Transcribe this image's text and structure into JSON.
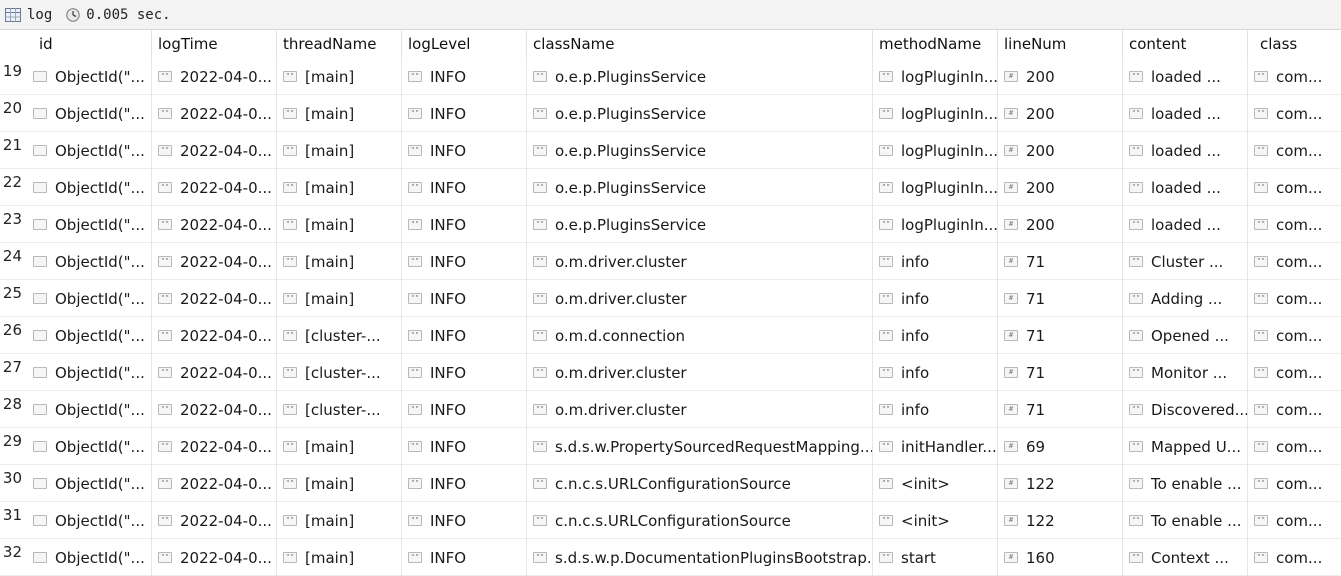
{
  "toolbar": {
    "collection": "log",
    "elapsed": "0.005 sec."
  },
  "columns": [
    "id",
    "logTime",
    "threadName",
    "logLevel",
    "className",
    "methodName",
    "lineNum",
    "content",
    "class"
  ],
  "rows": [
    {
      "n": "19",
      "id": "ObjectId(\"...",
      "logTime": "2022-04-0...",
      "threadName": "[main]",
      "logLevel": "INFO",
      "className": "o.e.p.PluginsService",
      "methodName": "logPluginIn...",
      "lineNum": "200",
      "content": "loaded ...",
      "class": "com..."
    },
    {
      "n": "20",
      "id": "ObjectId(\"...",
      "logTime": "2022-04-0...",
      "threadName": "[main]",
      "logLevel": "INFO",
      "className": "o.e.p.PluginsService",
      "methodName": "logPluginIn...",
      "lineNum": "200",
      "content": "loaded ...",
      "class": "com..."
    },
    {
      "n": "21",
      "id": "ObjectId(\"...",
      "logTime": "2022-04-0...",
      "threadName": "[main]",
      "logLevel": "INFO",
      "className": "o.e.p.PluginsService",
      "methodName": "logPluginIn...",
      "lineNum": "200",
      "content": "loaded ...",
      "class": "com..."
    },
    {
      "n": "22",
      "id": "ObjectId(\"...",
      "logTime": "2022-04-0...",
      "threadName": "[main]",
      "logLevel": "INFO",
      "className": "o.e.p.PluginsService",
      "methodName": "logPluginIn...",
      "lineNum": "200",
      "content": "loaded ...",
      "class": "com..."
    },
    {
      "n": "23",
      "id": "ObjectId(\"...",
      "logTime": "2022-04-0...",
      "threadName": "[main]",
      "logLevel": "INFO",
      "className": "o.e.p.PluginsService",
      "methodName": "logPluginIn...",
      "lineNum": "200",
      "content": "loaded ...",
      "class": "com..."
    },
    {
      "n": "24",
      "id": "ObjectId(\"...",
      "logTime": "2022-04-0...",
      "threadName": "[main]",
      "logLevel": "INFO",
      "className": "o.m.driver.cluster",
      "methodName": "info",
      "lineNum": "71",
      "content": "Cluster ...",
      "class": "com..."
    },
    {
      "n": "25",
      "id": "ObjectId(\"...",
      "logTime": "2022-04-0...",
      "threadName": "[main]",
      "logLevel": "INFO",
      "className": "o.m.driver.cluster",
      "methodName": "info",
      "lineNum": "71",
      "content": "Adding ...",
      "class": "com..."
    },
    {
      "n": "26",
      "id": "ObjectId(\"...",
      "logTime": "2022-04-0...",
      "threadName": "[cluster-...",
      "logLevel": "INFO",
      "className": "o.m.d.connection",
      "methodName": "info",
      "lineNum": "71",
      "content": "Opened ...",
      "class": "com..."
    },
    {
      "n": "27",
      "id": "ObjectId(\"...",
      "logTime": "2022-04-0...",
      "threadName": "[cluster-...",
      "logLevel": "INFO",
      "className": "o.m.driver.cluster",
      "methodName": "info",
      "lineNum": "71",
      "content": "Monitor ...",
      "class": "com..."
    },
    {
      "n": "28",
      "id": "ObjectId(\"...",
      "logTime": "2022-04-0...",
      "threadName": "[cluster-...",
      "logLevel": "INFO",
      "className": "o.m.driver.cluster",
      "methodName": "info",
      "lineNum": "71",
      "content": "Discovered...",
      "class": "com..."
    },
    {
      "n": "29",
      "id": "ObjectId(\"...",
      "logTime": "2022-04-0...",
      "threadName": "[main]",
      "logLevel": "INFO",
      "className": "s.d.s.w.PropertySourcedRequestMapping...",
      "methodName": "initHandler...",
      "lineNum": "69",
      "content": "Mapped U...",
      "class": "com..."
    },
    {
      "n": "30",
      "id": "ObjectId(\"...",
      "logTime": "2022-04-0...",
      "threadName": "[main]",
      "logLevel": "INFO",
      "className": "c.n.c.s.URLConfigurationSource",
      "methodName": "<init>",
      "lineNum": "122",
      "content": "To enable ...",
      "class": "com..."
    },
    {
      "n": "31",
      "id": "ObjectId(\"...",
      "logTime": "2022-04-0...",
      "threadName": "[main]",
      "logLevel": "INFO",
      "className": "c.n.c.s.URLConfigurationSource",
      "methodName": "<init>",
      "lineNum": "122",
      "content": "To enable ...",
      "class": "com..."
    },
    {
      "n": "32",
      "id": "ObjectId(\"...",
      "logTime": "2022-04-0...",
      "threadName": "[main]",
      "logLevel": "INFO",
      "className": "s.d.s.w.p.DocumentationPluginsBootstrap...",
      "methodName": "start",
      "lineNum": "160",
      "content": "Context ...",
      "class": "com..."
    }
  ]
}
